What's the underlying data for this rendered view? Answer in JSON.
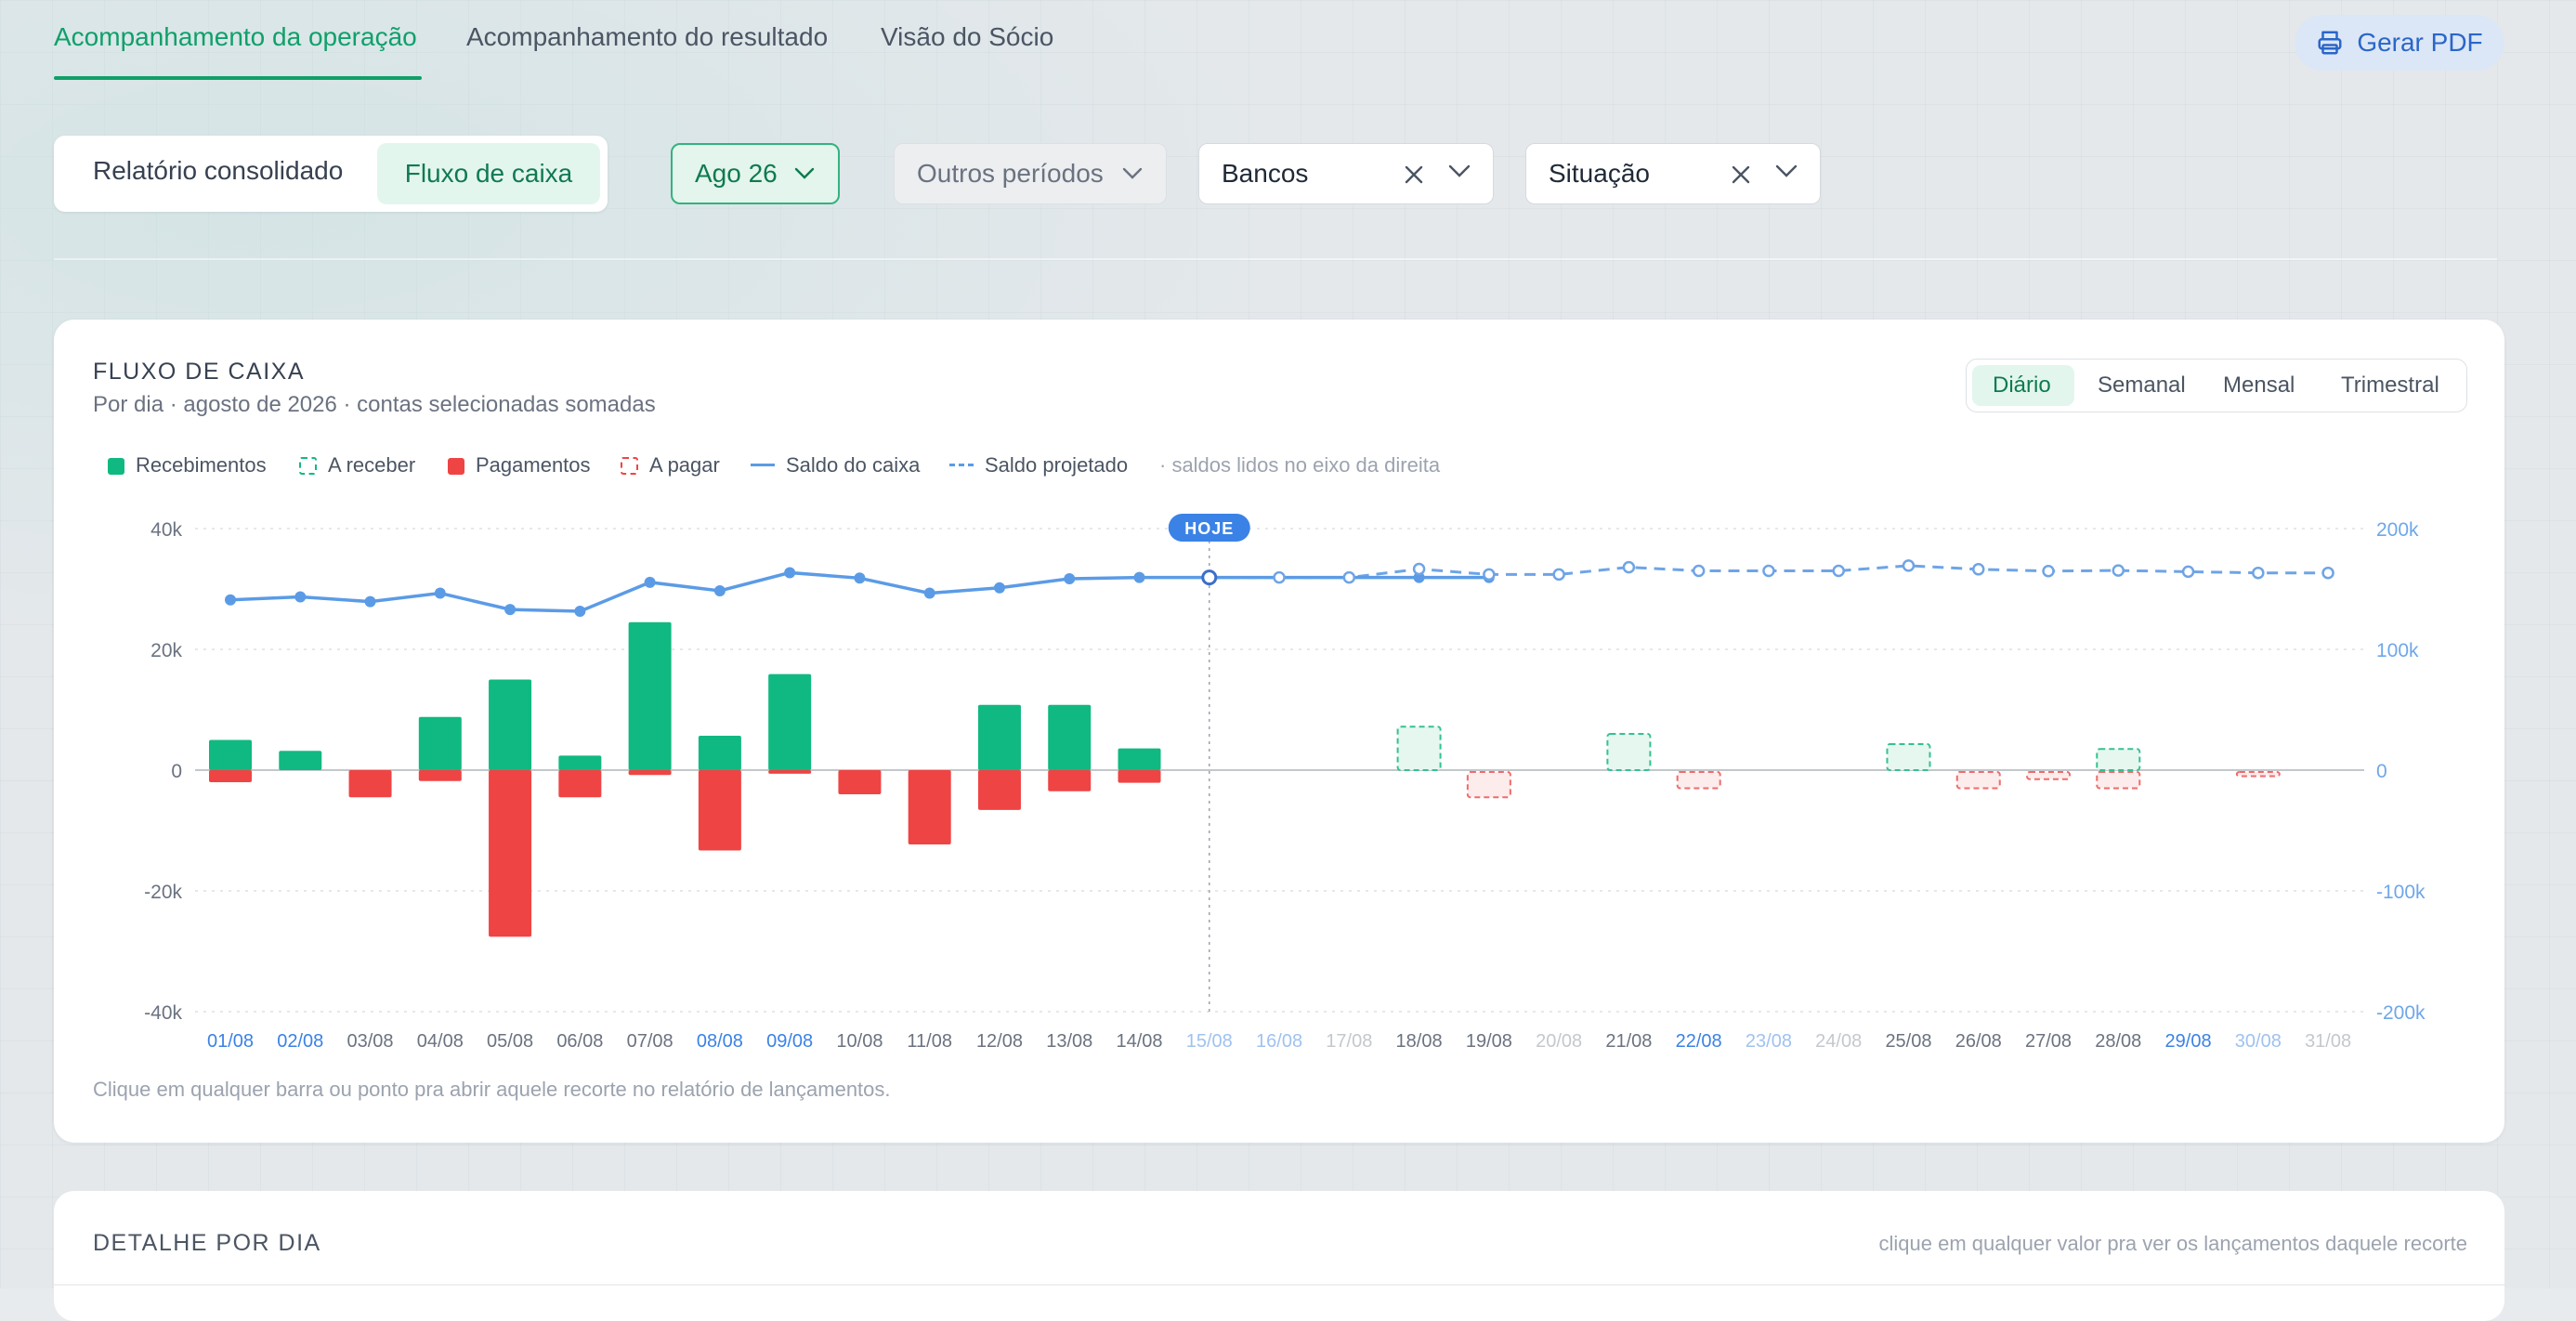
{
  "tabs": [
    {
      "label": "Acompanhamento da operação",
      "active": true
    },
    {
      "label": "Acompanhamento do resultado",
      "active": false
    },
    {
      "label": "Visão do Sócio",
      "active": false
    }
  ],
  "pdf_button": {
    "label": "Gerar PDF",
    "icon": "printer-icon"
  },
  "filters": {
    "report_toggle": {
      "option_1": "Relatório consolidado",
      "option_2": "Fluxo de caixa",
      "selected": "Fluxo de caixa"
    },
    "month": "Ago 26",
    "other_periods": "Outros períodos",
    "banks": "Bancos",
    "situation": "Situação"
  },
  "card": {
    "title": "FLUXO DE CAIXA",
    "subtitle": "Por dia · agosto de 2026 · contas selecionadas somadas",
    "periods": [
      "Diário",
      "Semanal",
      "Mensal",
      "Trimestral"
    ],
    "period_selected": "Diário",
    "legend": [
      "Recebimentos",
      "A receber",
      "Pagamentos",
      "A pagar",
      "Saldo do caixa",
      "Saldo projetado"
    ],
    "legend_note": "· saldos lidos no eixo da direita",
    "today_label": "HOJE",
    "footer_note": "Clique em qualquer barra ou ponto pra abrir aquele recorte no relatório de lançamentos."
  },
  "detail": {
    "title": "DETALHE POR DIA",
    "hint": "clique em qualquer valor pra ver os lançamentos daquele recorte"
  },
  "colors": {
    "accent_green": "#10b981",
    "accent_red": "#ef4444",
    "balance_blue": "#5b9be6",
    "brand_green": "#10a06a"
  },
  "chart_data": {
    "type": "bar",
    "categories": [
      "01/08",
      "02/08",
      "03/08",
      "04/08",
      "05/08",
      "06/08",
      "07/08",
      "08/08",
      "09/08",
      "10/08",
      "11/08",
      "12/08",
      "13/08",
      "14/08",
      "15/08",
      "16/08",
      "17/08",
      "18/08",
      "19/08",
      "20/08",
      "21/08",
      "22/08",
      "23/08",
      "24/08",
      "25/08",
      "26/08",
      "27/08",
      "28/08",
      "29/08",
      "30/08",
      "31/08"
    ],
    "y_left": {
      "ticks": [
        "40k",
        "20k",
        "0",
        "-20k",
        "-40k"
      ],
      "range": [
        -40000,
        40000
      ]
    },
    "y_right": {
      "ticks": [
        "200k",
        "100k",
        "0",
        "-100k",
        "-200k"
      ],
      "range": [
        -200000,
        200000
      ]
    },
    "today_index": 14,
    "series": [
      {
        "name": "Recebimentos",
        "values": [
          5000,
          3200,
          0,
          8800,
          15000,
          2400,
          24500,
          5700,
          15900,
          0,
          0,
          10800,
          10800,
          3600,
          0,
          0,
          0,
          0,
          0,
          0,
          0,
          0,
          0,
          0,
          0,
          0,
          0,
          0,
          0,
          0,
          0
        ]
      },
      {
        "name": "A receber",
        "values": [
          0,
          0,
          0,
          0,
          0,
          0,
          0,
          0,
          0,
          0,
          0,
          0,
          0,
          0,
          0,
          0,
          0,
          7200,
          0,
          0,
          6000,
          0,
          0,
          0,
          4300,
          0,
          0,
          3500,
          0,
          0,
          0
        ]
      },
      {
        "name": "Pagamentos",
        "values": [
          -2000,
          0,
          -4500,
          -1800,
          -27600,
          -4500,
          -800,
          -13300,
          -600,
          -4000,
          -12300,
          -6600,
          -3500,
          -2100,
          0,
          0,
          0,
          0,
          0,
          0,
          0,
          0,
          0,
          0,
          0,
          0,
          0,
          0,
          0,
          0,
          0
        ]
      },
      {
        "name": "A pagar",
        "values": [
          0,
          0,
          0,
          0,
          0,
          0,
          0,
          0,
          0,
          0,
          0,
          0,
          0,
          0,
          0,
          0,
          0,
          0,
          -4500,
          0,
          0,
          -3000,
          0,
          0,
          0,
          -3000,
          -1500,
          -3000,
          0,
          -1000,
          0
        ]
      },
      {
        "name": "Saldo do caixa",
        "axis": "right",
        "values": [
          141000,
          143500,
          139500,
          146500,
          133000,
          131500,
          155500,
          148500,
          163500,
          159000,
          146500,
          151000,
          158500,
          159500,
          159500,
          159500,
          159500,
          159500,
          159500,
          null,
          null,
          null,
          null,
          null,
          null,
          null,
          null,
          null,
          null,
          null,
          null
        ]
      },
      {
        "name": "Saldo projetado",
        "axis": "right",
        "values": [
          null,
          null,
          null,
          null,
          null,
          null,
          null,
          null,
          null,
          null,
          null,
          null,
          null,
          null,
          159500,
          159500,
          159500,
          166500,
          162000,
          162000,
          168000,
          165000,
          165000,
          165000,
          169300,
          166300,
          164800,
          165300,
          164300,
          163300,
          163300
        ]
      }
    ],
    "highlighted_labels_blue": [
      "01/08",
      "02/08",
      "08/08",
      "09/08",
      "22/08",
      "29/08"
    ],
    "light_labels": [
      "15/08",
      "16/08",
      "17/08",
      "20/08",
      "23/08",
      "24/08",
      "30/08",
      "31/08"
    ]
  }
}
